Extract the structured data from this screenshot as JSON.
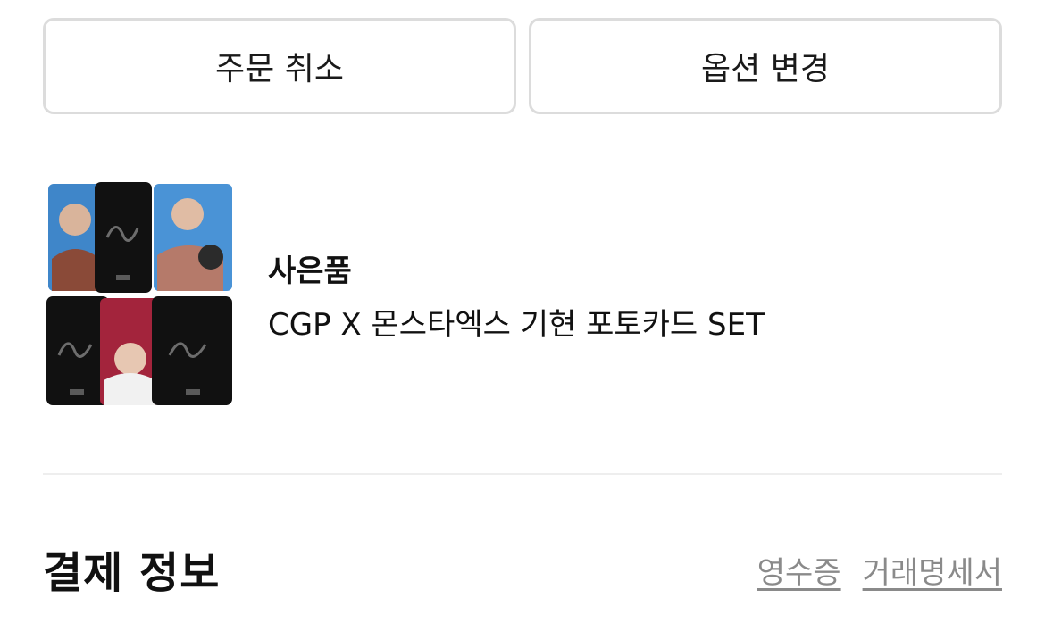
{
  "actions": {
    "cancel_order": "주문 취소",
    "change_option": "옵션 변경"
  },
  "gift": {
    "label": "사은품",
    "name": "CGP X 몬스타엑스 기현 포토카드 SET"
  },
  "payment": {
    "title": "결제 정보",
    "receipt_link": "영수증",
    "statement_link": "거래명세서"
  }
}
